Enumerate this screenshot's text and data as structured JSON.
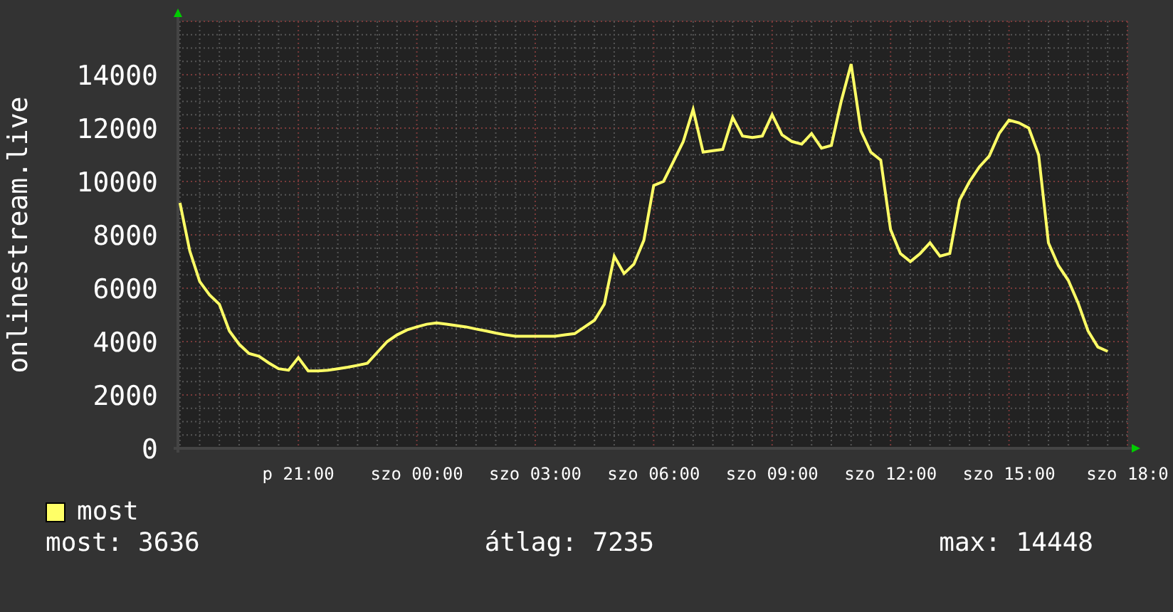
{
  "chart": {
    "chart_data": {
      "type": "line",
      "ylabel": "onlinestream.live",
      "categories": [
        null,
        null,
        null,
        null,
        null,
        null,
        null,
        null,
        null,
        null,
        null,
        null,
        "p 21:00",
        null,
        null,
        null,
        null,
        null,
        null,
        null,
        null,
        null,
        null,
        null,
        "szo 00:00",
        null,
        null,
        null,
        null,
        null,
        null,
        null,
        null,
        null,
        null,
        null,
        "szo 03:00",
        null,
        null,
        null,
        null,
        null,
        null,
        null,
        null,
        null,
        null,
        null,
        "szo 06:00",
        null,
        null,
        null,
        null,
        null,
        null,
        null,
        null,
        null,
        null,
        null,
        "szo 09:00",
        null,
        null,
        null,
        null,
        null,
        null,
        null,
        null,
        null,
        null,
        null,
        "szo 12:00",
        null,
        null,
        null,
        null,
        null,
        null,
        null,
        null,
        null,
        null,
        null,
        "szo 15:00",
        null,
        null,
        null,
        null,
        null,
        null,
        null,
        null,
        null,
        null,
        null,
        "szo 18:0"
      ],
      "series": [
        {
          "name": "most",
          "color": "#ffff66",
          "values": [
            9200,
            7400,
            6250,
            5750,
            5400,
            4400,
            3900,
            3550,
            3450,
            3200,
            2980,
            2930,
            3400,
            2900,
            2900,
            2930,
            2980,
            3040,
            3110,
            3190,
            3600,
            4000,
            4250,
            4440,
            4550,
            4650,
            4700,
            4650,
            4600,
            4550,
            4470,
            4400,
            4320,
            4250,
            4200,
            4200,
            4200,
            4200,
            4200,
            4250,
            4300,
            4550,
            4800,
            5400,
            7200,
            6550,
            6900,
            7800,
            9850,
            10000,
            10750,
            11500,
            12700,
            11100,
            11150,
            11200,
            12400,
            11700,
            11650,
            11700,
            12500,
            11750,
            11500,
            11400,
            11800,
            11250,
            11350,
            13000,
            14400,
            11900,
            11100,
            10800,
            8200,
            7300,
            7000,
            7300,
            7700,
            7200,
            7300,
            9300,
            10000,
            10550,
            10950,
            11800,
            12300,
            12200,
            12000,
            11000,
            7700,
            6850,
            6300,
            5450,
            4400,
            3800,
            3630,
            null,
            null
          ]
        }
      ],
      "ylim": [
        0,
        16000
      ],
      "grid": true,
      "yticks": [
        0,
        2000,
        4000,
        6000,
        8000,
        10000,
        12000,
        14000
      ]
    }
  },
  "stats": [
    "most: 3636",
    "átlag: 7235",
    "max: 14448"
  ]
}
